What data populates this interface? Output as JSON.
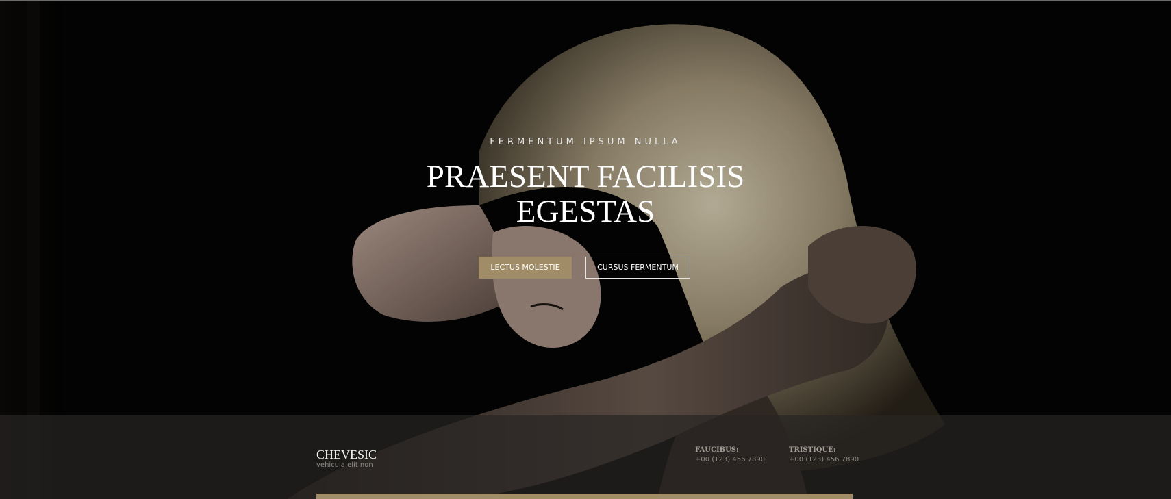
{
  "hero": {
    "kicker": "FERMENTUM IPSUM NULLA",
    "title_line_1": "PRAESENT FACILISIS",
    "title_line_2": "EGESTAS",
    "primary_button": "LECTUS MOLESTIE",
    "secondary_button": "CURSUS FERMENTUM",
    "image": "woman-tying-hair-photo"
  },
  "footer_band": {
    "brand_name": "CHEVESIC",
    "brand_tagline": "vehicula elit non",
    "contacts": [
      {
        "label": "FAUCIBUS:",
        "value": "+00 (123) 456 7890"
      },
      {
        "label": "TRISTIQUE:",
        "value": "+00 (123) 456 7890"
      }
    ]
  },
  "colors": {
    "accent": "#a08d68",
    "background": "#050505",
    "band": "#2a2826"
  }
}
